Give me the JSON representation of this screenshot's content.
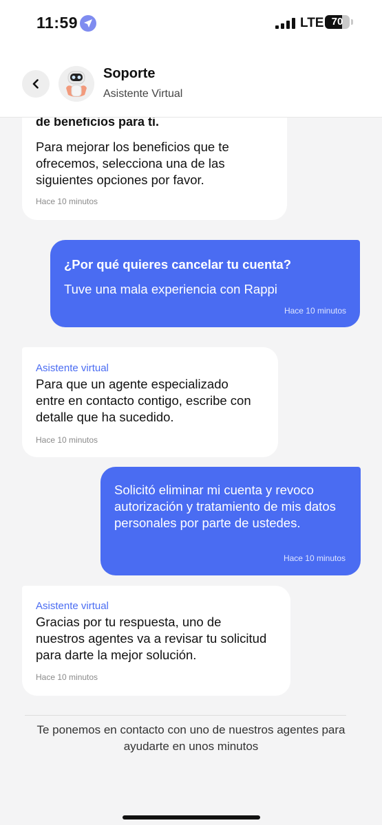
{
  "status_bar": {
    "time": "11:59",
    "network": "LTE",
    "battery_level": "70",
    "battery_fraction": 0.7
  },
  "header": {
    "back_icon": "chevron-left-icon",
    "title": "Soporte",
    "subtitle": "Asistente Virtual"
  },
  "messages": [
    {
      "sender": "bot",
      "cut_top_text": "de beneficios para ti.",
      "text": "Para mejorar los beneficios que te ofrecemos, selecciona una de las siguientes opciones por favor.",
      "time": "Hace 10 minutos"
    },
    {
      "sender": "user",
      "question": "¿Por qué quieres cancelar tu cuenta?",
      "text": "Tuve una mala experiencia con Rappi",
      "time": "Hace 10 minutos"
    },
    {
      "sender": "bot",
      "label": "Asistente virtual",
      "text": "Para que un agente especializado entre en contacto contigo, escribe con detalle que ha sucedido.",
      "time": "Hace 10 minutos"
    },
    {
      "sender": "user",
      "text": "Solicitó eliminar mi cuenta y revoco autorización y tratamiento de mis datos personales por parte de ustedes.",
      "time": "Hace 10 minutos"
    },
    {
      "sender": "bot",
      "label": "Asistente virtual",
      "text": "Gracias por tu respuesta, uno de nuestros agentes va a revisar tu solicitud para darte la mejor solución.",
      "time": "Hace 10 minutos"
    }
  ],
  "footer": {
    "text": "Te ponemos en contacto con uno de nuestros agentes para ayudarte en unos minutos"
  },
  "colors": {
    "accent": "#4a6cf2",
    "background": "#f4f4f5",
    "bot_bubble": "#ffffff"
  }
}
